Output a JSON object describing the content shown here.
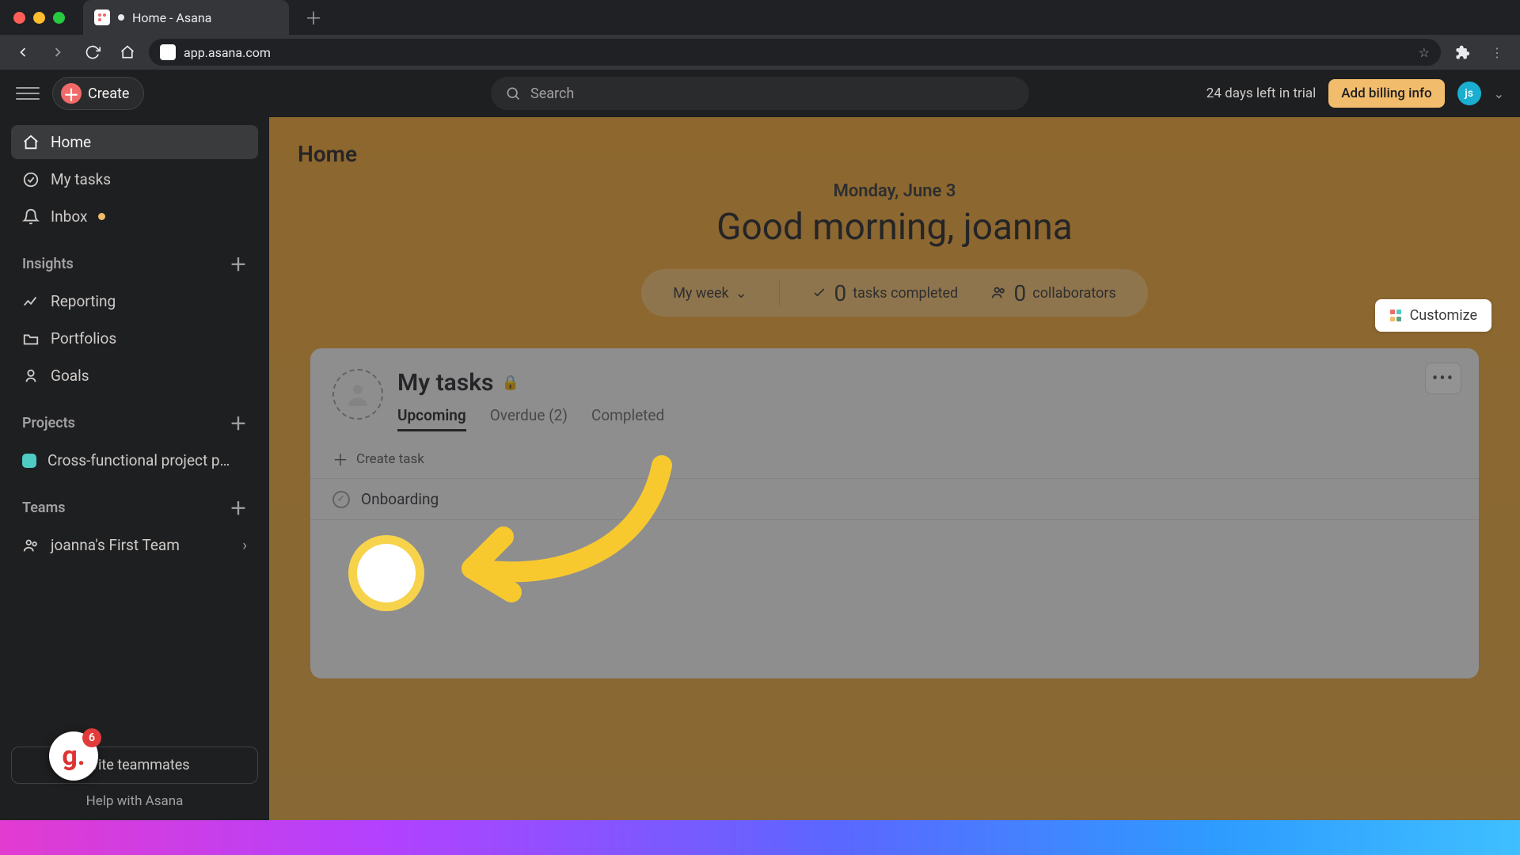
{
  "browser": {
    "tab_title": "Home - Asana",
    "url": "app.asana.com"
  },
  "topbar": {
    "create_label": "Create",
    "search_placeholder": "Search",
    "trial_text": "24 days left in trial",
    "billing_label": "Add billing info",
    "avatar_initials": "js"
  },
  "sidebar": {
    "items": [
      {
        "label": "Home"
      },
      {
        "label": "My tasks"
      },
      {
        "label": "Inbox"
      }
    ],
    "insights_heading": "Insights",
    "insights": [
      {
        "label": "Reporting"
      },
      {
        "label": "Portfolios"
      },
      {
        "label": "Goals"
      }
    ],
    "projects_heading": "Projects",
    "projects": [
      {
        "label": "Cross-functional project p…"
      }
    ],
    "teams_heading": "Teams",
    "teams": [
      {
        "label": "joanna's First Team"
      }
    ],
    "invite_label": "Invite teammates",
    "help_label": "Help with Asana",
    "g_badge_count": "6"
  },
  "main": {
    "page_title": "Home",
    "date": "Monday, June 3",
    "greeting": "Good morning, joanna",
    "stats": {
      "my_week": "My week",
      "tasks_count": "0",
      "tasks_label": "tasks completed",
      "collab_count": "0",
      "collab_label": "collaborators"
    },
    "customize_label": "Customize"
  },
  "card": {
    "title": "My tasks",
    "tabs": {
      "upcoming": "Upcoming",
      "overdue": "Overdue (2)",
      "completed": "Completed"
    },
    "create_task": "Create task",
    "task_name": "Onboarding"
  }
}
